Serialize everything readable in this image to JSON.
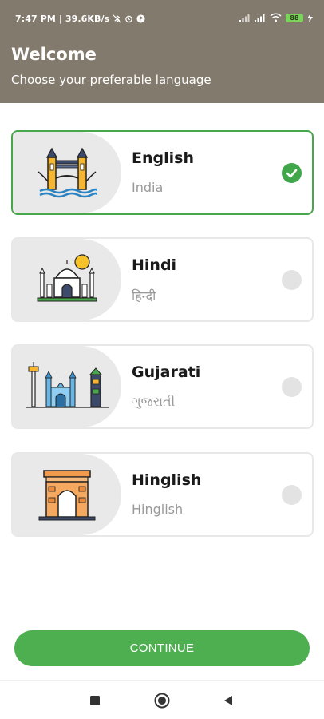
{
  "status_bar": {
    "time_speed": "7:47 PM | 39.6KB/s",
    "battery": "88",
    "icons": [
      "bluetooth-off-icon",
      "alarm-icon",
      "app-notification-icon",
      "signal-icon",
      "signal-icon",
      "wifi-icon",
      "battery-icon",
      "charging-icon"
    ]
  },
  "header": {
    "title": "Welcome",
    "subtitle": "Choose your preferable language"
  },
  "languages": [
    {
      "name": "English",
      "native": "India",
      "selected": true,
      "icon": "tower-bridge-icon"
    },
    {
      "name": "Hindi",
      "native": "हिन्दी",
      "selected": false,
      "icon": "taj-mahal-icon"
    },
    {
      "name": "Gujarati",
      "native": "ગુજરાતી",
      "selected": false,
      "icon": "gujarat-monuments-icon"
    },
    {
      "name": "Hinglish",
      "native": "Hinglish",
      "selected": false,
      "icon": "india-gate-icon"
    }
  ],
  "continue_label": "CONTINUE",
  "colors": {
    "header_bg": "#837a6e",
    "accent": "#4daf50",
    "selected_border": "#46a84a"
  },
  "navbar": {
    "buttons": [
      "recents-button",
      "home-button",
      "back-button"
    ]
  }
}
